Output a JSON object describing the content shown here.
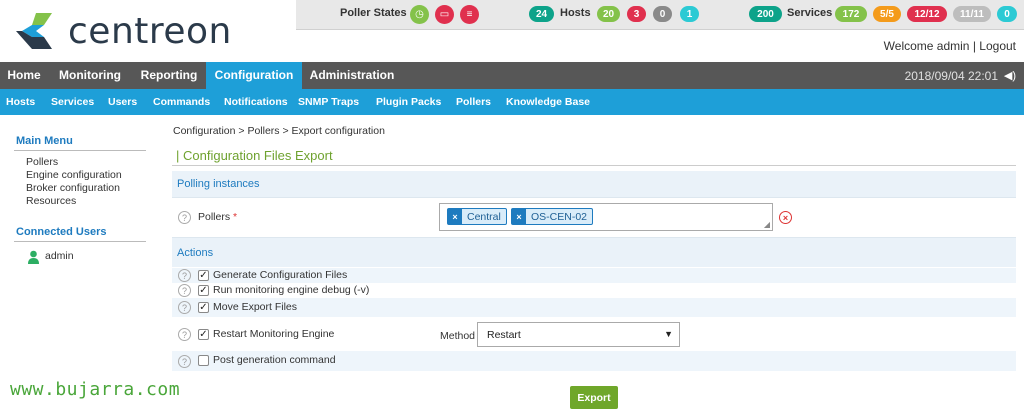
{
  "brand": {
    "name": "centreon"
  },
  "statusbar": {
    "poller_states_label": "Poller States",
    "hosts": {
      "total": "24",
      "label": "Hosts",
      "up": "20",
      "down": "3",
      "unreachable": "0",
      "pending": "1"
    },
    "services": {
      "total": "200",
      "label": "Services",
      "ok": "172",
      "warning": "5/5",
      "critical": "12/12",
      "unknown": "11/11",
      "pending": "0"
    }
  },
  "user": {
    "welcome": "Welcome admin",
    "separator": "|",
    "logout": "Logout"
  },
  "main_nav": {
    "tabs": [
      "Home",
      "Monitoring",
      "Reporting",
      "Configuration",
      "Administration"
    ],
    "active": "Configuration"
  },
  "clock": "2018/09/04 22:01",
  "sub_nav": [
    "Hosts",
    "Services",
    "Users",
    "Commands",
    "Notifications",
    "SNMP Traps",
    "Plugin Packs",
    "Pollers",
    "Knowledge Base"
  ],
  "sidebar": {
    "main_menu_title": "Main Menu",
    "items": [
      "Pollers",
      "Engine configuration",
      "Broker configuration",
      "Resources"
    ],
    "connected_users_title": "Connected Users",
    "users": [
      "admin"
    ]
  },
  "breadcrumb": {
    "items": [
      "Configuration",
      "Pollers",
      "Export configuration"
    ],
    "separator": ">"
  },
  "page": {
    "title": "| Configuration Files Export",
    "polling_section": "Polling instances",
    "pollers_label": "Pollers",
    "required_marker": "*",
    "selected_pollers": [
      "Central",
      "OS-CEN-02"
    ],
    "actions_section": "Actions",
    "actions": [
      {
        "label": "Generate Configuration Files",
        "checked": true
      },
      {
        "label": "Run monitoring engine debug (-v)",
        "checked": true
      },
      {
        "label": "Move Export Files",
        "checked": true
      },
      {
        "label": "Restart Monitoring Engine",
        "checked": true
      },
      {
        "label": "Post generation command",
        "checked": false
      }
    ],
    "method_label": "Method",
    "method_value": "Restart",
    "export_button": "Export"
  },
  "watermark": "www.bujarra.com",
  "colors": {
    "accent": "#1e9fd8",
    "nav_bg": "#575757",
    "export_green": "#6fa72a",
    "title_green": "#6fa22f"
  }
}
